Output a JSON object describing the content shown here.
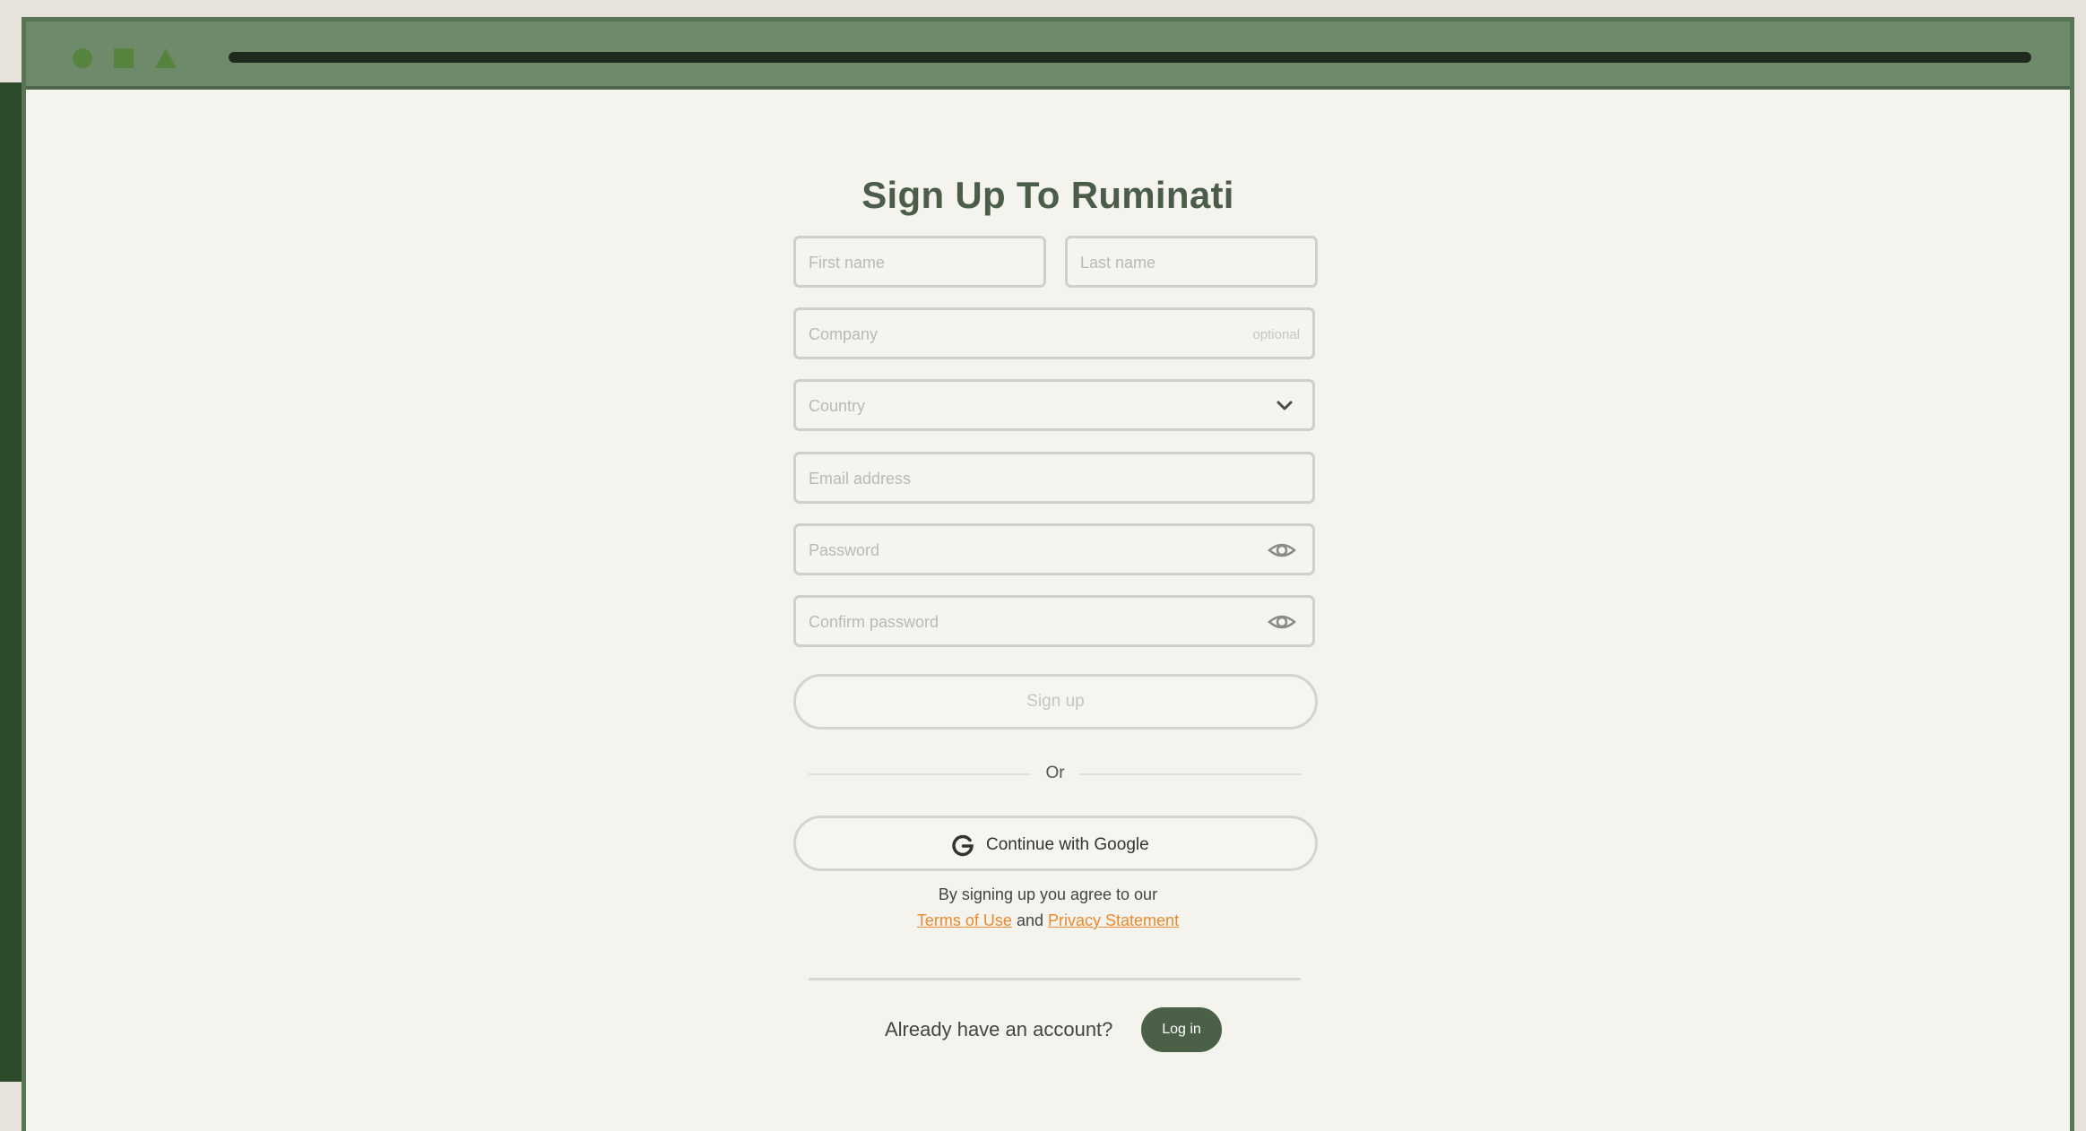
{
  "window": {
    "controls": [
      "circle-control-icon",
      "square-control-icon",
      "triangle-control-icon"
    ]
  },
  "form": {
    "title": "Sign Up To Ruminati",
    "first_name": {
      "placeholder": "First name",
      "value": ""
    },
    "last_name": {
      "placeholder": "Last name",
      "value": ""
    },
    "company": {
      "placeholder": "Company",
      "hint": "optional",
      "value": ""
    },
    "country": {
      "placeholder": "Country",
      "selected": ""
    },
    "email": {
      "placeholder": "Email address",
      "value": ""
    },
    "password": {
      "placeholder": "Password",
      "value": ""
    },
    "confirm_password": {
      "placeholder": "Confirm password",
      "value": ""
    },
    "signup_label": "Sign up",
    "divider_label": "Or",
    "google_label": "Continue with Google",
    "agree_text": "By signing up you agree to our",
    "terms_label": "Terms of Use",
    "and_text": "and",
    "privacy_label": "Privacy Statement",
    "already_text": "Already have an account?",
    "login_label": "Log in"
  },
  "colors": {
    "brand_green": "#4a6147",
    "link_orange": "#e88a2d",
    "titlebar": "#6f8a6b",
    "page_bg": "#f4f3ee"
  }
}
